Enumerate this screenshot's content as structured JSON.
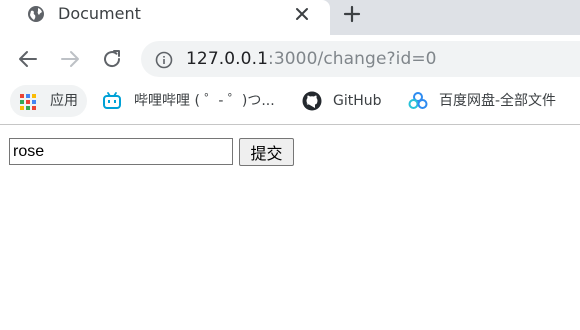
{
  "tab": {
    "title": "Document",
    "favicon": "globe-icon",
    "close_icon": "close-icon",
    "new_tab_icon": "plus-icon"
  },
  "toolbar": {
    "url_host": "127.0.0.1",
    "url_rest": ":3000/change?id=0",
    "back_icon": "arrow-left-icon",
    "forward_icon": "arrow-right-icon",
    "reload_icon": "reload-icon",
    "info_icon": "info-icon"
  },
  "bookmarks": [
    {
      "label": "应用",
      "icon": "apps-grid-icon"
    },
    {
      "label": "哔哩哔哩 ( ゜- ゜)つ...",
      "icon": "bilibili-icon"
    },
    {
      "label": "GitHub",
      "icon": "github-icon"
    },
    {
      "label": "百度网盘-全部文件",
      "icon": "baidu-pan-icon"
    }
  ],
  "form": {
    "input_value": "rose",
    "submit_label": "提交"
  },
  "colors": {
    "tabstrip_bg": "#dee1e6",
    "omnibox_bg": "#f1f3f4",
    "bilibili": "#00a1d6"
  }
}
